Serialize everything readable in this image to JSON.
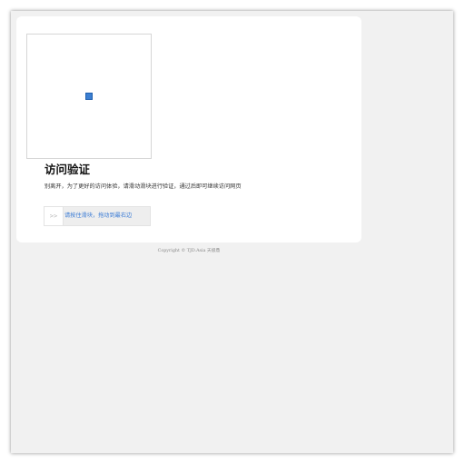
{
  "verification": {
    "title": "访问验证",
    "description": "别离开，为了更好的访问体验，请滑动滑块进行验证，通过后即可继续访问网页",
    "slider_handle_glyph": ">>",
    "slider_hint": "请按住滑块，拖动到最右边"
  },
  "footer": {
    "copyright": "Copyright © TJD.Asia 天极鼎"
  },
  "colors": {
    "page_background": "#f1f1f1",
    "card_background": "#ffffff",
    "slider_hint_text": "#3a7bd5"
  }
}
